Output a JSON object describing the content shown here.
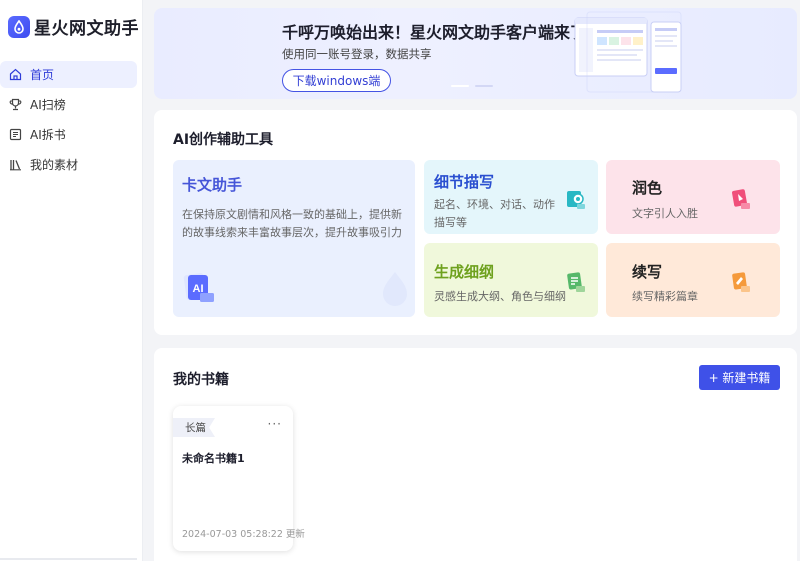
{
  "app": {
    "name": "星火网文助手"
  },
  "sidebar": {
    "items": [
      {
        "label": "首页",
        "icon": "home-icon",
        "active": true
      },
      {
        "label": "AI扫榜",
        "icon": "trophy-icon",
        "active": false
      },
      {
        "label": "AI拆书",
        "icon": "book-open-icon",
        "active": false
      },
      {
        "label": "我的素材",
        "icon": "library-icon",
        "active": false
      }
    ]
  },
  "banner": {
    "title": "千呼万唤始出来！星火网文助手客户端来了",
    "subtitle": "使用同一账号登录，数据共享",
    "button_label": "下载windows端"
  },
  "tools": {
    "section_title": "AI创作辅助工具",
    "items": [
      {
        "title": "卡文助手",
        "desc": "在保持原文剧情和风格一致的基础上，提供新的故事线索来丰富故事层次，提升故事吸引力",
        "color": "#4656d8",
        "bg": "#eaf0fe"
      },
      {
        "title": "细节描写",
        "desc": "起名、环境、对话、动作描写等",
        "color": "#2a4fd0",
        "bg": "#e4f6fb"
      },
      {
        "title": "润色",
        "desc": "文字引人入胜",
        "color": "#222",
        "bg": "#fde3ea"
      },
      {
        "title": "生成细纲",
        "desc": "灵感生成大纲、角色与细纲",
        "color": "#6ea11e",
        "bg": "#f0f8db"
      },
      {
        "title": "续写",
        "desc": "续写精彩篇章",
        "color": "#222",
        "bg": "#ffe9d9"
      }
    ]
  },
  "books": {
    "section_title": "我的书籍",
    "new_button": "+ 新建书籍",
    "list": [
      {
        "tag": "长篇",
        "name": "未命名书籍1",
        "updated": "2024-07-03 05:28:22 更新"
      }
    ]
  }
}
